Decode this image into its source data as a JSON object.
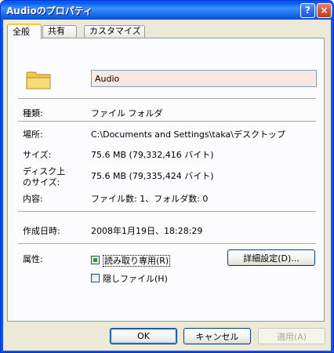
{
  "window": {
    "title": "Audioのプロパティ",
    "help_label": "?",
    "close_label": "×"
  },
  "tabs": [
    {
      "label": "全般",
      "active": true
    },
    {
      "label": "共有",
      "active": false
    },
    {
      "label": "カスタマイズ",
      "active": false
    }
  ],
  "general": {
    "name": "Audio",
    "type_label": "種類:",
    "type_value": "ファイル フォルダ",
    "location_label": "場所:",
    "location_value": "C:\\Documents and Settings\\taka\\デスクトップ",
    "size_label": "サイズ:",
    "size_value": "75.6 MB (79,332,416 バイト)",
    "disk_size_label_1": "ディスク上",
    "disk_size_label_2": "のサイズ:",
    "disk_size_value": "75.6 MB (79,335,424 バイト)",
    "contents_label": "内容:",
    "contents_value": "ファイル数: 1、フォルダ数: 0",
    "created_label": "作成日時:",
    "created_value": "2008年1月19日、18:28:29",
    "attributes_label": "属性:",
    "readonly_label": "読み取り専用(R)",
    "readonly_checked": true,
    "hidden_label": "隠しファイル(H)",
    "hidden_checked": false,
    "advanced_button": "詳細設定(D)..."
  },
  "footer": {
    "ok": "OK",
    "cancel": "キャンセル",
    "apply": "適用(A)"
  },
  "colors": {
    "titlebar": "#0a5ef8",
    "dialog_bg": "#ece9d8",
    "name_field_bg": "#fde8e0",
    "active_tab_accent": "#ffc83c",
    "checkbox_fill": "#21a121"
  },
  "icons": {
    "folder": "folder-icon",
    "help": "help-icon",
    "close": "close-icon"
  }
}
